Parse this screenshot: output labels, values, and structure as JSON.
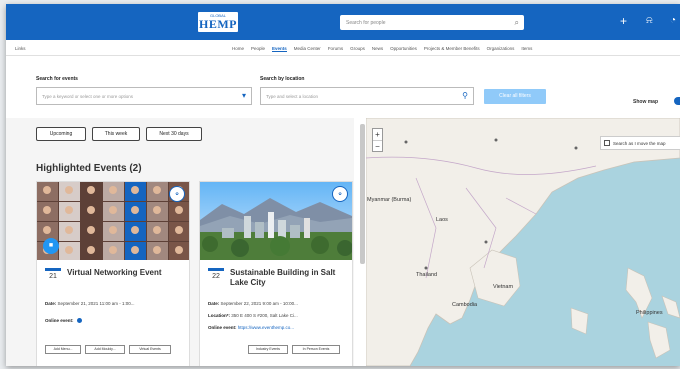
{
  "header": {
    "logo_small": "GLOBAL",
    "logo_big": "HEMP",
    "search_placeholder": "Search for people",
    "icons": [
      "plus-icon",
      "bell-icon",
      "user-icon"
    ]
  },
  "nav": {
    "links": "Links",
    "tabs": [
      "Home",
      "People",
      "Events",
      "Media Center",
      "Forums",
      "Groups",
      "News",
      "Opportunities",
      "Projects & Member Benefits",
      "Organizations",
      "Items"
    ],
    "active_tab": "Events"
  },
  "filters": {
    "events_label": "Search for events",
    "events_placeholder": "Type a keyword or select one or more options",
    "location_label": "Search by location",
    "location_placeholder": "Type and select a location",
    "clear_label": "Clear all filters",
    "show_map_label": "Show map",
    "show_map_on": true
  },
  "quick_filters": [
    "Upcoming",
    "This week",
    "Next 30 days"
  ],
  "highlighted_title": "Highlighted Events (2)",
  "events": [
    {
      "day": "21",
      "title": "Virtual Networking Event",
      "date_label": "Date:",
      "date_value": "September 21, 2021 11:00 am - 1:00...",
      "online_label": "Online event:",
      "online_value": "",
      "buttons": [
        "Add Menu...",
        "Add Mouldy...",
        "Virtual Events"
      ],
      "badge": "HEMP"
    },
    {
      "day": "22",
      "title": "Sustainable Building in Salt Lake City",
      "date_label": "Date:",
      "date_value": "September 22, 2021 9:00 am - 10:00...",
      "location_label": "Location*:",
      "location_value": "350 E 400 S #200, Salt Lake Ci...",
      "online_label": "Online event:",
      "online_value": "https://www.eventhemp.co...",
      "buttons": [
        "Industry Events",
        "In Person Events"
      ],
      "badge": "HEMP"
    }
  ],
  "map": {
    "search_as_move": "Search as I move the map",
    "zoom_in": "+",
    "zoom_out": "−",
    "labels": [
      "Myanmar (Burma)",
      "Laos",
      "Thailand",
      "Vietnam",
      "Cambodia",
      "Philippines"
    ]
  },
  "colors": {
    "primary": "#1565c0",
    "land": "#f2efe9",
    "water": "#aad3df"
  }
}
